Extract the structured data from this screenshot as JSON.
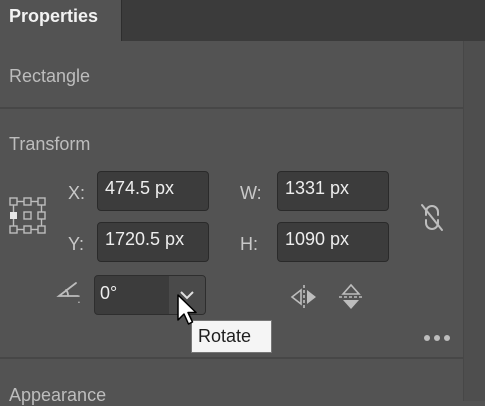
{
  "panel": {
    "tab_label": "Properties"
  },
  "sections": {
    "shape_label": "Rectangle",
    "transform_label": "Transform",
    "appearance_label": "Appearance"
  },
  "transform": {
    "x_label": "X:",
    "x_value": "474.5 px",
    "y_label": "Y:",
    "y_value": "1720.5 px",
    "w_label": "W:",
    "w_value": "1331 px",
    "h_label": "H:",
    "h_value": "1090 px",
    "angle_value": "0°"
  },
  "tooltip": {
    "text": "Rotate"
  },
  "icons": {
    "reference_point": "reference-point-icon",
    "constrain": "unlink-proportions-icon",
    "angle": "angle-icon",
    "dropdown": "chevron-down-icon",
    "flip_horizontal": "flip-horizontal-icon",
    "flip_vertical": "flip-vertical-icon",
    "more": "more-options-icon",
    "cursor": "mouse-pointer-icon"
  },
  "colors": {
    "panel_bg": "#535353",
    "tab_bar_bg": "#3b3b3b",
    "field_bg": "#3c3c3c",
    "tooltip_bg": "#f5f5f5"
  }
}
